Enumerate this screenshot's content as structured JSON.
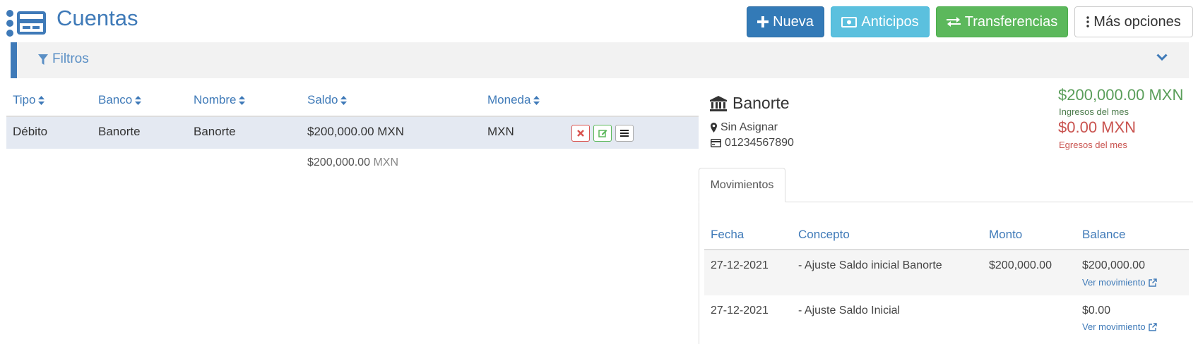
{
  "header": {
    "title": "Cuentas",
    "buttons": {
      "nueva": "Nueva",
      "anticipos": "Anticipos",
      "transferencias": "Transferencias",
      "mas_opciones": "Más opciones"
    }
  },
  "filters": {
    "label": "Filtros"
  },
  "accounts_table": {
    "columns": [
      "Tipo",
      "Banco",
      "Nombre",
      "Saldo",
      "Moneda"
    ],
    "rows": [
      {
        "tipo": "Débito",
        "banco": "Banorte",
        "nombre": "Banorte",
        "saldo": "$200,000.00 MXN",
        "moneda": "MXN"
      }
    ],
    "total": {
      "amount": "$200,000.00",
      "currency": "MXN"
    }
  },
  "account_detail": {
    "bank_name": "Banorte",
    "location": "Sin Asignar",
    "account_number": "01234567890",
    "ingresos_amount": "$200,000.00 MXN",
    "ingresos_label": "Ingresos del mes",
    "egresos_amount": "$0.00 MXN",
    "egresos_label": "Egresos del mes",
    "tab": "Movimientos",
    "movements": {
      "columns": [
        "Fecha",
        "Concepto",
        "Monto",
        "Balance"
      ],
      "rows": [
        {
          "fecha": "27-12-2021",
          "concepto": "- Ajuste Saldo inicial Banorte",
          "monto": "$200,000.00",
          "balance": "$200,000.00",
          "link": "Ver movimiento"
        },
        {
          "fecha": "27-12-2021",
          "concepto": "- Ajuste Saldo Inicial",
          "monto": "",
          "balance": "$0.00",
          "link": "Ver movimiento"
        }
      ]
    }
  },
  "colors": {
    "primary": "#337ab7",
    "info": "#5bc0de",
    "success": "#5cb85c",
    "danger": "#d9534f",
    "brand_blue": "#3f7ab8"
  },
  "icons": {
    "logo": "credit-card-list-icon",
    "nueva": "plus-icon",
    "anticipos": "money-icon",
    "transferencias": "exchange-icon",
    "mas_opciones": "ellipsis-vertical-icon",
    "filtros": "filter-icon",
    "expand": "chevron-down-icon",
    "sort": "sort-icon",
    "bank": "bank-icon",
    "location": "map-marker-icon",
    "card": "credit-card-icon",
    "external": "external-link-icon"
  }
}
